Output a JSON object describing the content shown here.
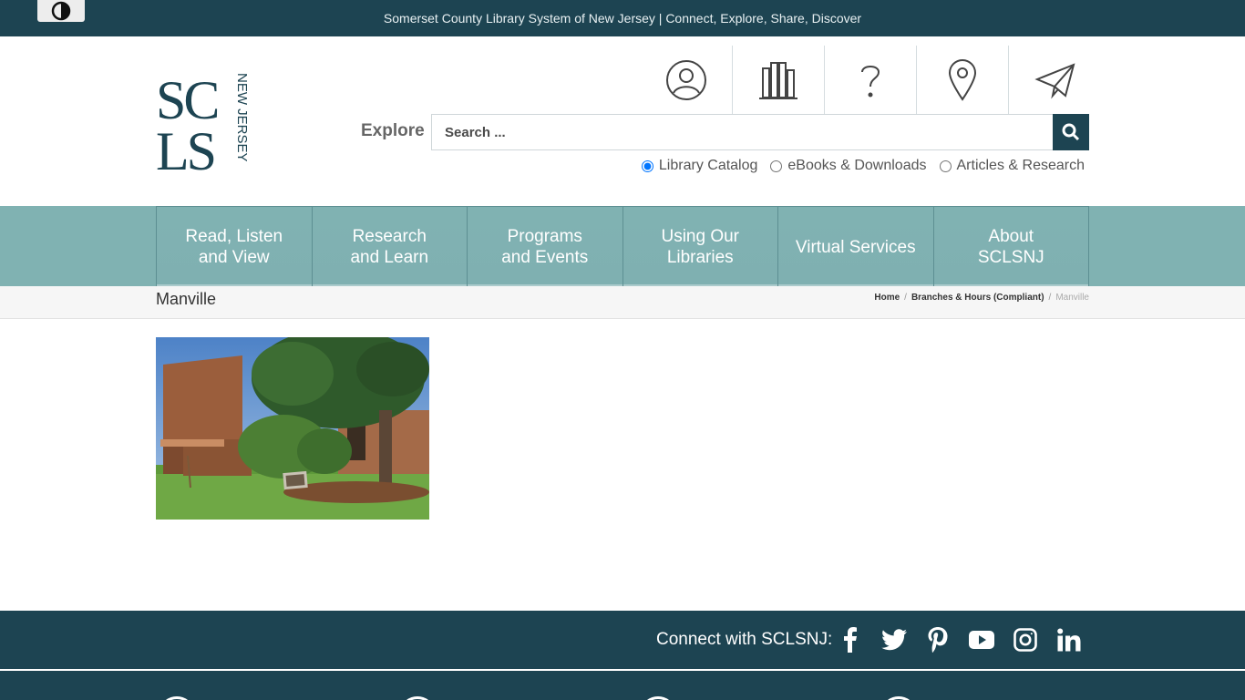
{
  "topbar": {
    "tagline": "Somerset County Library System of New Jersey | Connect, Explore, Share, Discover"
  },
  "logo": {
    "text": "SCLS",
    "subtext": "NEW JERSEY"
  },
  "quicklinks": [
    {
      "icon": "user-icon"
    },
    {
      "icon": "books-icon"
    },
    {
      "icon": "question-icon"
    },
    {
      "icon": "location-pin-icon"
    },
    {
      "icon": "paper-plane-icon"
    }
  ],
  "search": {
    "label": "Explore",
    "placeholder": "Search ...",
    "options": [
      "Library Catalog",
      "eBooks & Downloads",
      "Articles & Research"
    ],
    "selected": "Library Catalog"
  },
  "nav": {
    "items": [
      {
        "line1": "Read, Listen",
        "line2": "and View"
      },
      {
        "line1": "Research",
        "line2": "and Learn"
      },
      {
        "line1": "Programs",
        "line2": "and Events"
      },
      {
        "line1": "Using Our",
        "line2": "Libraries"
      },
      {
        "line1": "Virtual Services",
        "line2": ""
      },
      {
        "line1": "About",
        "line2": "SCLSNJ"
      }
    ]
  },
  "page": {
    "title": "Manville",
    "breadcrumb": [
      "Home",
      "Branches & Hours (Compliant)",
      "Manville"
    ]
  },
  "footer": {
    "connect_label": "Connect with SCLSNJ:",
    "social": [
      "facebook-icon",
      "twitter-icon",
      "pinterest-icon",
      "youtube-icon",
      "instagram-icon",
      "linkedin-icon"
    ]
  },
  "colors": {
    "primary": "#1d4452",
    "nav": "#80b2b2",
    "logo": "#1d4452"
  }
}
